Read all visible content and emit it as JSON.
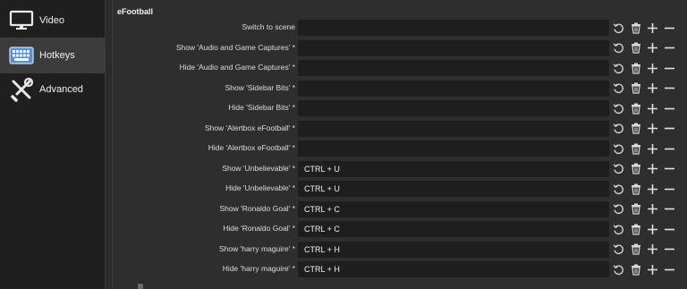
{
  "sidebar": {
    "items": [
      {
        "label": "Video",
        "icon": "monitor-icon",
        "selected": false
      },
      {
        "label": "Hotkeys",
        "icon": "keyboard-icon",
        "selected": true
      },
      {
        "label": "Advanced",
        "icon": "tools-icon",
        "selected": false
      }
    ]
  },
  "group": {
    "title": "eFootball"
  },
  "hotkeys": [
    {
      "label": "Switch to scene",
      "keys": ""
    },
    {
      "label": "Show 'Audio and Game Captures' *",
      "keys": ""
    },
    {
      "label": "Hide 'Audio and Game Captures' *",
      "keys": ""
    },
    {
      "label": "Show 'Sidebar Bits' *",
      "keys": ""
    },
    {
      "label": "Hide 'Sidebar Bits' *",
      "keys": ""
    },
    {
      "label": "Show 'Alertbox eFootball' *",
      "keys": ""
    },
    {
      "label": "Hide 'Alertbox eFootball' *",
      "keys": ""
    },
    {
      "label": "Show 'Unbelievable' *",
      "keys": "CTRL + U"
    },
    {
      "label": "Hide 'Unbelievable' *",
      "keys": "CTRL + U"
    },
    {
      "label": "Show 'Ronaldo Goal' *",
      "keys": "CTRL + C"
    },
    {
      "label": "Hide 'Ronaldo Goal' *",
      "keys": "CTRL + C"
    },
    {
      "label": "Show 'harry maguire' *",
      "keys": "CTRL + H"
    },
    {
      "label": "Hide 'harry maguire' *",
      "keys": "CTRL + H"
    }
  ],
  "colors": {
    "background": "#2b2b2b",
    "sidebar": "#1f1f1f",
    "selected": "#3c3c3c",
    "field": "#1e1e1e",
    "text": "#e6e6e6"
  }
}
